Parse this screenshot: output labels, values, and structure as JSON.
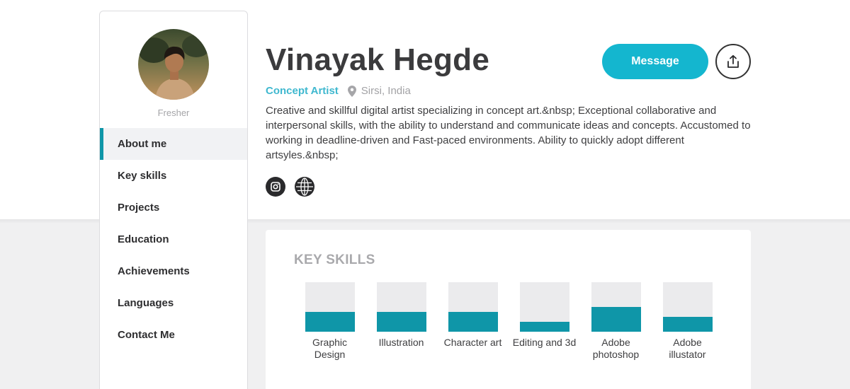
{
  "profile": {
    "name": "Vinayak Hegde",
    "role": "Concept Artist",
    "location": "Sirsi, India",
    "status": "Fresher",
    "bio": "Creative and skillful digital artist specializing in concept art.&nbsp; Exceptional collaborative and interpersonal skills, with the ability to understand and communicate ideas and concepts. Accustomed to working in deadline-driven and Fast-paced environments. Ability to quickly adopt different artsyles.&nbsp;"
  },
  "actions": {
    "message_label": "Message",
    "share_icon": "share-upload-icon"
  },
  "socials": [
    {
      "icon": "instagram-icon"
    },
    {
      "icon": "globe-icon"
    }
  ],
  "nav": {
    "active_index": 0,
    "items": [
      {
        "label": "About me"
      },
      {
        "label": "Key skills"
      },
      {
        "label": "Projects"
      },
      {
        "label": "Education"
      },
      {
        "label": "Achievements"
      },
      {
        "label": "Languages"
      },
      {
        "label": "Contact Me"
      }
    ]
  },
  "skills": {
    "title": "KEY SKILLS",
    "items": [
      {
        "label": "Graphic Design",
        "level": 0.4
      },
      {
        "label": "Illustration",
        "level": 0.4
      },
      {
        "label": "Character art",
        "level": 0.4
      },
      {
        "label": "Editing and 3d",
        "level": 0.2
      },
      {
        "label": "Adobe photoshop",
        "level": 0.5
      },
      {
        "label": "Adobe illustator",
        "level": 0.3
      }
    ]
  },
  "colors": {
    "accent": "#14b6cf",
    "skill_fill": "#0f96a8",
    "role_text": "#3fb8cf"
  }
}
